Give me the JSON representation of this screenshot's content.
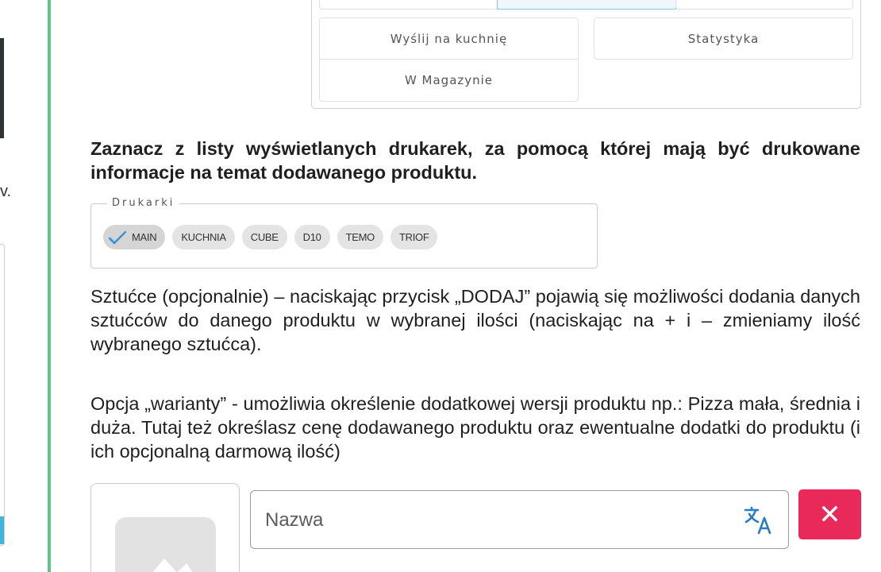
{
  "left_pane": {
    "stray_char": "v."
  },
  "sub_buttons": {
    "send_to_kitchen": "Wyślij na kuchnię",
    "statistics": "Statystyka",
    "in_warehouse": "W Magazynie"
  },
  "printers_intro": "Zaznacz z listy wyświetlanych drukarek, za pomocą której mają być drukowane informacje na temat dodawanego produktu.",
  "printers": {
    "legend": "Drukarki",
    "items": [
      {
        "label": "MAIN",
        "selected": true
      },
      {
        "label": "KUCHNIA",
        "selected": false
      },
      {
        "label": "CUBE",
        "selected": false
      },
      {
        "label": "D10",
        "selected": false
      },
      {
        "label": "TEMO",
        "selected": false
      },
      {
        "label": "TRIOF",
        "selected": false
      }
    ]
  },
  "cutlery_text": "Sztućce (opcjonalnie) – naciskając przycisk „DODAJ” pojawią się możliwości dodania danych sztućców do danego produktu w wybranej ilości (naciskając na + i – zmieniamy ilość wybranego sztućca).",
  "variants_text": "Opcja „warianty” - umożliwia określenie dodatkowej wersji produktu np.: Pizza mała, średnia i duża. Tutaj też określasz cenę dodawanego produktu oraz ewentualne dodatki do produktu (i ich opcjonalną darmową ilość)",
  "variant_form": {
    "name_placeholder": "Nazwa",
    "name_value": "",
    "remove_glyph": "✕"
  },
  "colors": {
    "accent_green": "#5fc48a",
    "remove_red": "#e8295a",
    "check_blue": "#3f8fd1",
    "translate_blue": "#2a7cc7"
  },
  "icons": [
    "check-icon",
    "translate-icon",
    "image-placeholder-icon",
    "close-icon"
  ]
}
